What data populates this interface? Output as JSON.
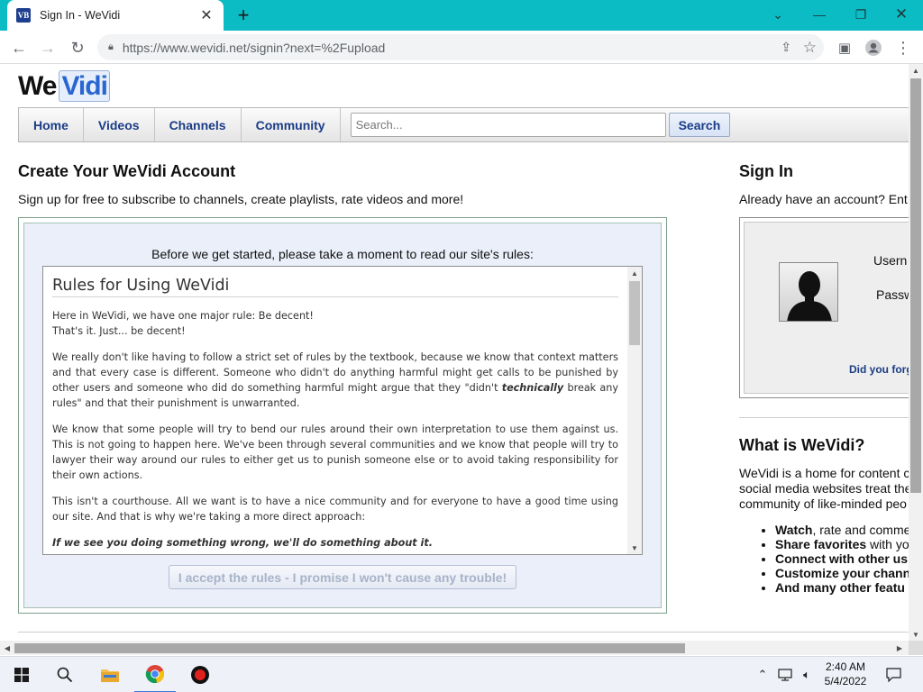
{
  "browser": {
    "tab_title": "Sign In - WeVidi",
    "favicon_text": "VB",
    "url": "https://www.wevidi.net/signin?next=%2Fupload"
  },
  "site": {
    "logo_we": "We",
    "logo_vidi": "Vidi",
    "nav": [
      "Home",
      "Videos",
      "Channels",
      "Community"
    ],
    "search_placeholder": "Search...",
    "search_button": "Search"
  },
  "create": {
    "heading": "Create Your WeVidi Account",
    "subtitle": "Sign up for free to subscribe to channels, create playlists, rate videos and more!",
    "intro": "Before we get started, please take a moment to read our site's rules:",
    "rules_title": "Rules for Using WeVidi",
    "p1_line1": "Here in WeVidi, we have one major rule: Be decent!",
    "p1_line2": "That's it. Just... be decent!",
    "p2_a": "We really don't like having to follow a strict set of rules by the textbook, because we know that context matters and that every case is different. Someone who didn't do anything harmful might get calls to be punished by other users and someone who did do something harmful might argue that they \"didn't ",
    "p2_em": "technically",
    "p2_b": " break any rules\" and that their punishment is unwarranted.",
    "p3": "We know that some people will try to bend our rules around their own interpretation to use them against us. This is not going to happen here. We've been through several communities and we know that people will try to lawyer their way around our rules to either get us to punish someone else or to avoid taking responsibility for their own actions.",
    "p4": "This isn't a courthouse. All we want is to have a nice community and for everyone to have a good time using our site. And that is why we're taking a more direct approach:",
    "p5": "If we see you doing something wrong, we'll do something about it.",
    "accept_button": "I accept the rules - I promise I won't cause any trouble!"
  },
  "signin": {
    "heading": "Sign In",
    "subtitle": "Already have an account? Ent",
    "username_label": "Usern",
    "password_label": "Passw",
    "forgot_link": "Did you forg"
  },
  "what": {
    "heading": "What is WeVidi?",
    "line1": "WeVidi is a home for content c",
    "line2": "social media websites treat the",
    "line3": "community of like-minded peo",
    "features": [
      {
        "bold": "Watch",
        "rest": ", rate and comme"
      },
      {
        "bold": "Share favorites",
        "rest": " with yo"
      },
      {
        "bold": "Connect with other us",
        "rest": ""
      },
      {
        "bold": "Customize your chann",
        "rest": ""
      },
      {
        "bold": "And many other featu",
        "rest": ""
      }
    ]
  },
  "taskbar": {
    "time": "2:40 AM",
    "date": "5/4/2022"
  },
  "colors": {
    "chrome_teal": "#0cbcc4",
    "nav_text": "#1b3c86",
    "rules_bg": "#eaeff9"
  }
}
